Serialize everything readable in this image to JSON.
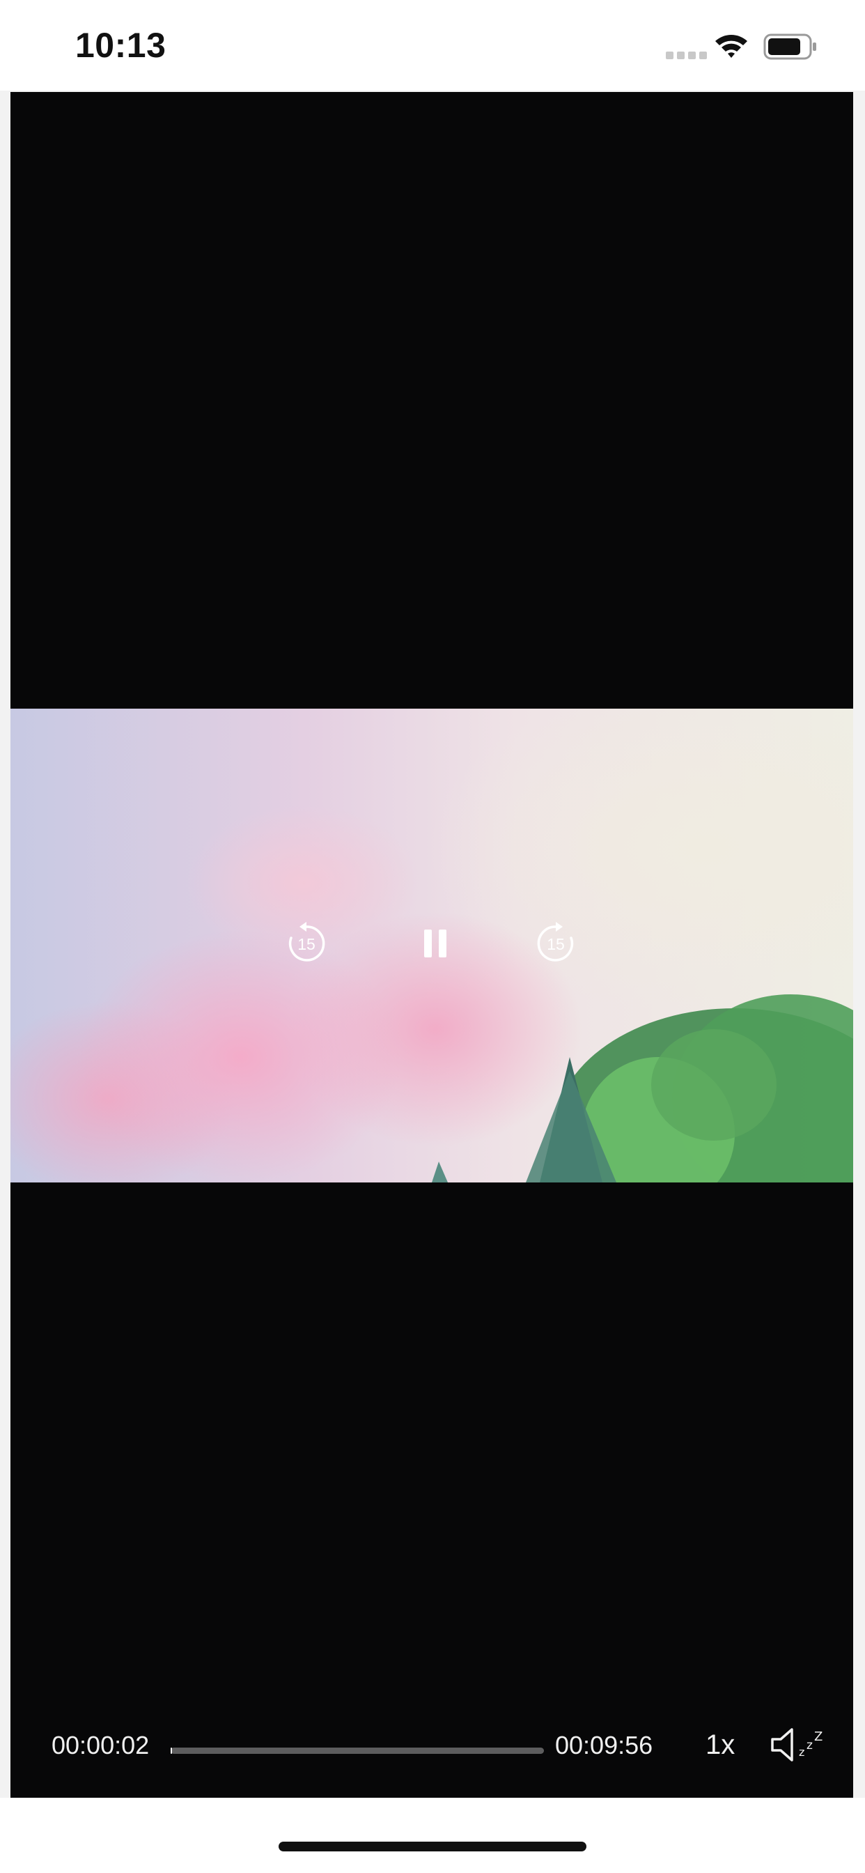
{
  "status_bar": {
    "time": "10:13",
    "wifi_icon": "wifi-icon",
    "battery_icon": "battery-icon"
  },
  "player": {
    "skip_back_seconds": "15",
    "skip_forward_seconds": "15",
    "play_state_icon": "pause-icon",
    "current_time": "00:00:02",
    "total_time": "00:09:56",
    "progress_fraction": 0.0034,
    "speed_label": "1x",
    "mute_icon": "speaker-muted-icon"
  },
  "colors": {
    "player_background": "#070708",
    "control_text": "#f0f0f0"
  }
}
